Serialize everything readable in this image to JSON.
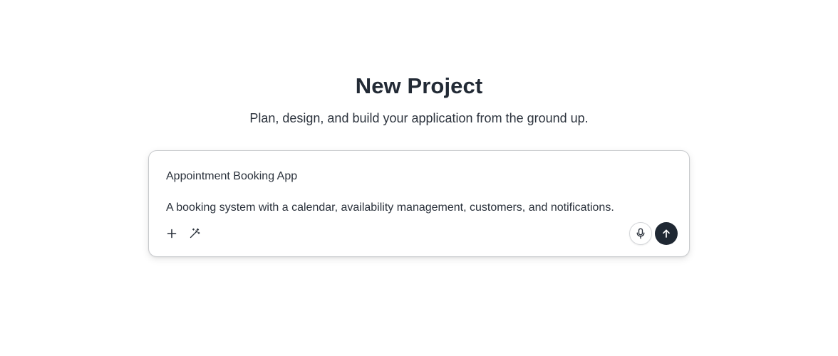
{
  "header": {
    "title": "New Project",
    "subtitle": "Plan, design, and build your application from the ground up."
  },
  "composer": {
    "project_name": "Appointment Booking App",
    "project_description": "A booking system with a calendar, availability management, customers, and notifications.",
    "icons": {
      "add": "plus-icon",
      "enhance": "magic-wand-icon",
      "voice": "microphone-icon",
      "send": "arrow-up-icon"
    }
  },
  "colors": {
    "text_primary": "#222a35",
    "send_button": "#1f2833",
    "border": "#c9cbce"
  }
}
